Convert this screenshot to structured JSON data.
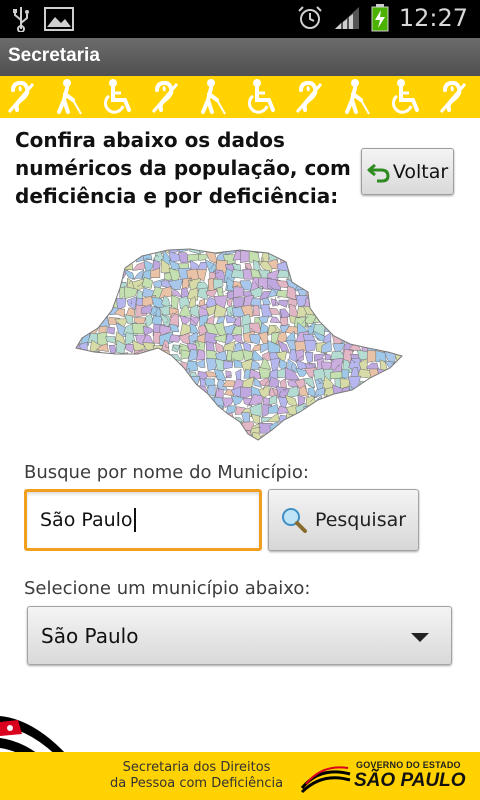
{
  "status_bar": {
    "time": "12:27",
    "icons": [
      "usb-icon",
      "image-icon",
      "alarm-icon",
      "signal-icon",
      "battery-charging-icon"
    ]
  },
  "app": {
    "title": "Secretaria"
  },
  "icon_strip": {
    "icons": [
      "hearing-icon",
      "blind-walking-icon",
      "wheelchair-icon"
    ],
    "background": "#ffd200"
  },
  "main": {
    "heading": "Confira abaixo os dados numéricos da população, com deficiência e por deficiência:",
    "back_button_label": "Voltar",
    "map_label": "",
    "search": {
      "label": "Busque por nome do Município:",
      "value": "São Paulo",
      "button_label": "Pesquisar"
    },
    "select": {
      "label": "Selecione um município abaixo:",
      "selected": "São Paulo"
    }
  },
  "footer": {
    "secretaria_line1": "Secretaria dos Direitos",
    "secretaria_line2": "da Pessoa com Deficiência",
    "gov_top": "GOVERNO DO ESTADO",
    "gov_name": "SÃO PAULO"
  },
  "colors": {
    "accent_yellow": "#ffd200",
    "input_focus": "#f0a01e",
    "title_bar": "#5c5c5c"
  }
}
